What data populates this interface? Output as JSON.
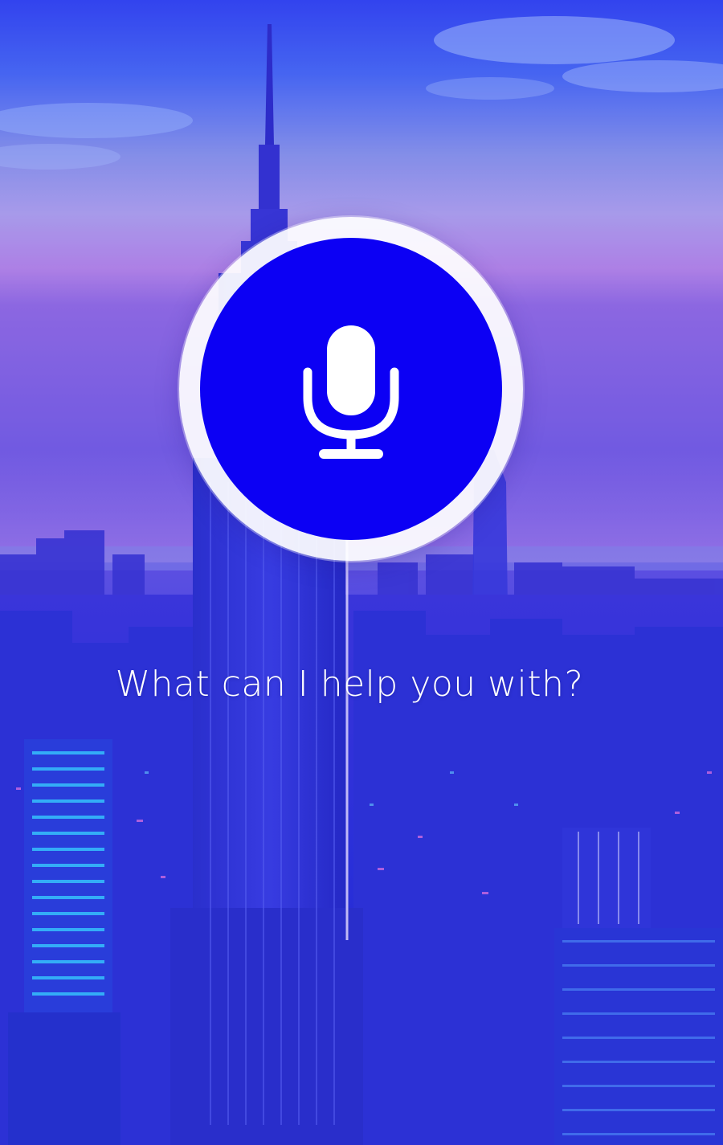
{
  "assistant": {
    "prompt_text": "What can I help you with?",
    "mic_button_icon": "microphone-icon"
  },
  "background": {
    "scene": "city skyline at dusk"
  },
  "colors": {
    "mic_button_fill": "#0c00f4",
    "mic_ring": "#ffffff",
    "prompt_text": "#ffffff",
    "sky_top": "#3a4ff0",
    "sky_horizon": "#b98ae6",
    "city_tint": "#2330d8"
  }
}
